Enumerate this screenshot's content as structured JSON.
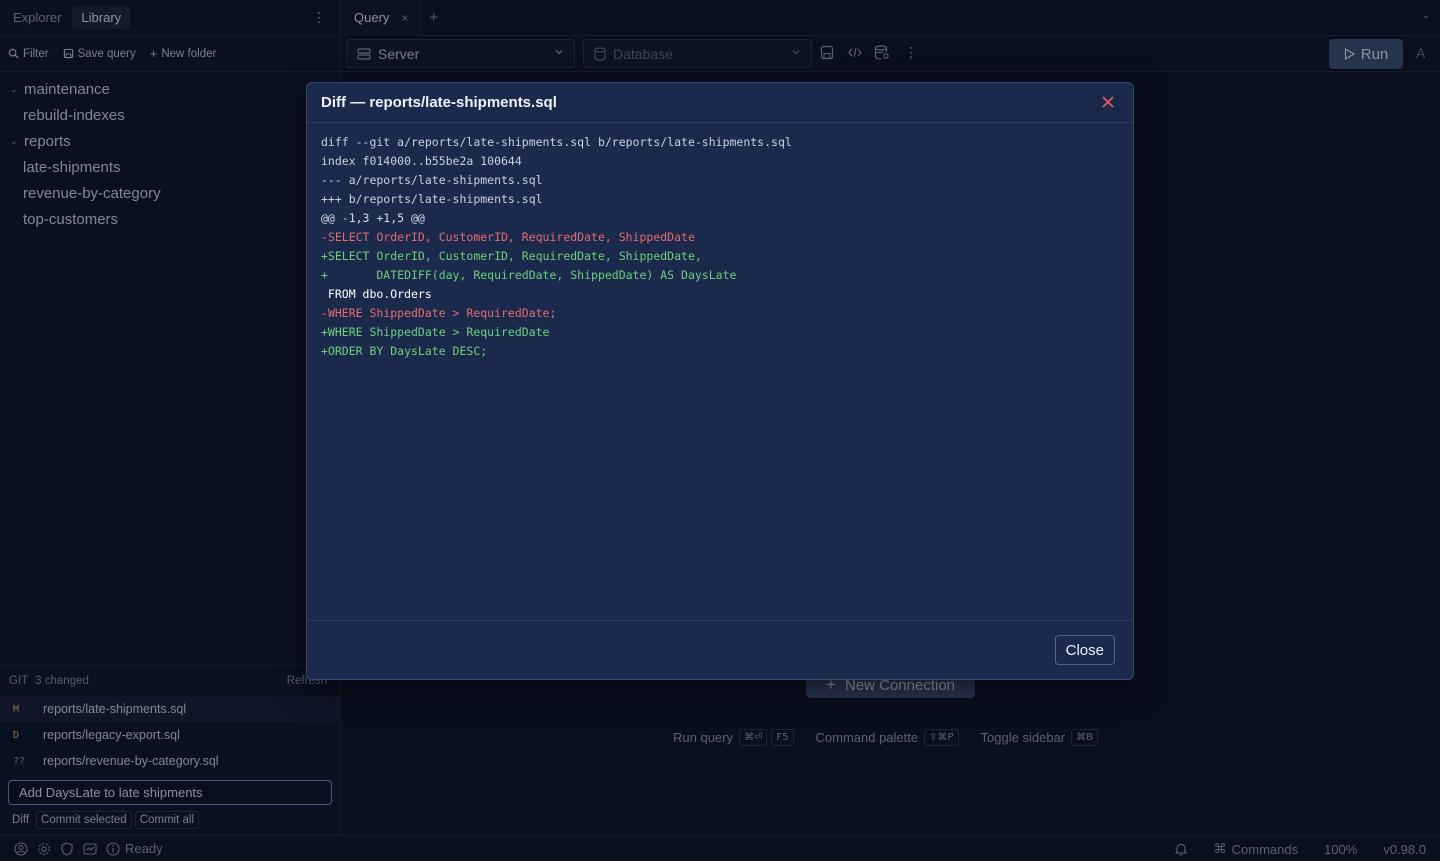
{
  "sidebar": {
    "tabs": [
      {
        "label": "Explorer"
      },
      {
        "label": "Library"
      }
    ],
    "tools": {
      "filter": "Filter",
      "save_query": "Save query",
      "new_folder": "New folder"
    },
    "tree": [
      {
        "label": "maintenance",
        "kind": "folder"
      },
      {
        "label": "rebuild-indexes",
        "kind": "file"
      },
      {
        "label": "reports",
        "kind": "folder"
      },
      {
        "label": "late-shipments",
        "kind": "file"
      },
      {
        "label": "revenue-by-category",
        "kind": "file"
      },
      {
        "label": "top-customers",
        "kind": "file"
      }
    ]
  },
  "git": {
    "label": "GIT",
    "changed": "3 changed",
    "refresh": "Refresh",
    "files": [
      {
        "status": "M",
        "path": "reports/late-shipments.sql"
      },
      {
        "status": "D",
        "path": "reports/legacy-export.sql"
      },
      {
        "status": "??",
        "path": "reports/revenue-by-category.sql"
      }
    ],
    "commit_message": "Add DaysLate to late shipments",
    "actions": {
      "diff": "Diff",
      "commit_selected": "Commit selected",
      "commit_all": "Commit all"
    }
  },
  "topbar": {
    "tab_label": "Query",
    "tab_close": "×",
    "add_tab": "+"
  },
  "toolbar": {
    "server_placeholder": "Server",
    "database_placeholder": "Database",
    "run_label": "Run",
    "extra": "A"
  },
  "main": {
    "new_connection": "New Connection",
    "shortcuts": [
      {
        "label": "Run query",
        "keys": [
          "⌘⏎",
          "F5"
        ]
      },
      {
        "label": "Command palette",
        "keys": [
          "⇧⌘P"
        ]
      },
      {
        "label": "Toggle sidebar",
        "keys": [
          "⌘B"
        ]
      }
    ]
  },
  "status": {
    "ready": "Ready",
    "commands": "Commands",
    "zoom": "100%",
    "version": "v0.98.0"
  },
  "modal": {
    "title": "Diff — reports/late-shipments.sql",
    "close_label": "Close",
    "lines": [
      {
        "text": "diff --git a/reports/late-shipments.sql b/reports/late-shipments.sql",
        "kind": "meta"
      },
      {
        "text": "index f014000..b55be2a 100644",
        "kind": "meta"
      },
      {
        "text": "--- a/reports/late-shipments.sql",
        "kind": "meta"
      },
      {
        "text": "+++ b/reports/late-shipments.sql",
        "kind": "meta"
      },
      {
        "text": "@@ -1,3 +1,5 @@",
        "kind": "hunk"
      },
      {
        "text": "-SELECT OrderID, CustomerID, RequiredDate, ShippedDate",
        "kind": "del"
      },
      {
        "text": "+SELECT OrderID, CustomerID, RequiredDate, ShippedDate,",
        "kind": "add"
      },
      {
        "text": "+       DATEDIFF(day, RequiredDate, ShippedDate) AS DaysLate",
        "kind": "add"
      },
      {
        "text": " FROM dbo.Orders",
        "kind": "ctx"
      },
      {
        "text": "-WHERE ShippedDate > RequiredDate;",
        "kind": "del"
      },
      {
        "text": "+WHERE ShippedDate > RequiredDate",
        "kind": "add"
      },
      {
        "text": "+ORDER BY DaysLate DESC;",
        "kind": "add"
      }
    ]
  },
  "colors": {
    "accent": "#3a4c6e",
    "diff_add": "#6cd07a",
    "diff_del": "#e06c6c",
    "close_x": "#e05a5a"
  }
}
